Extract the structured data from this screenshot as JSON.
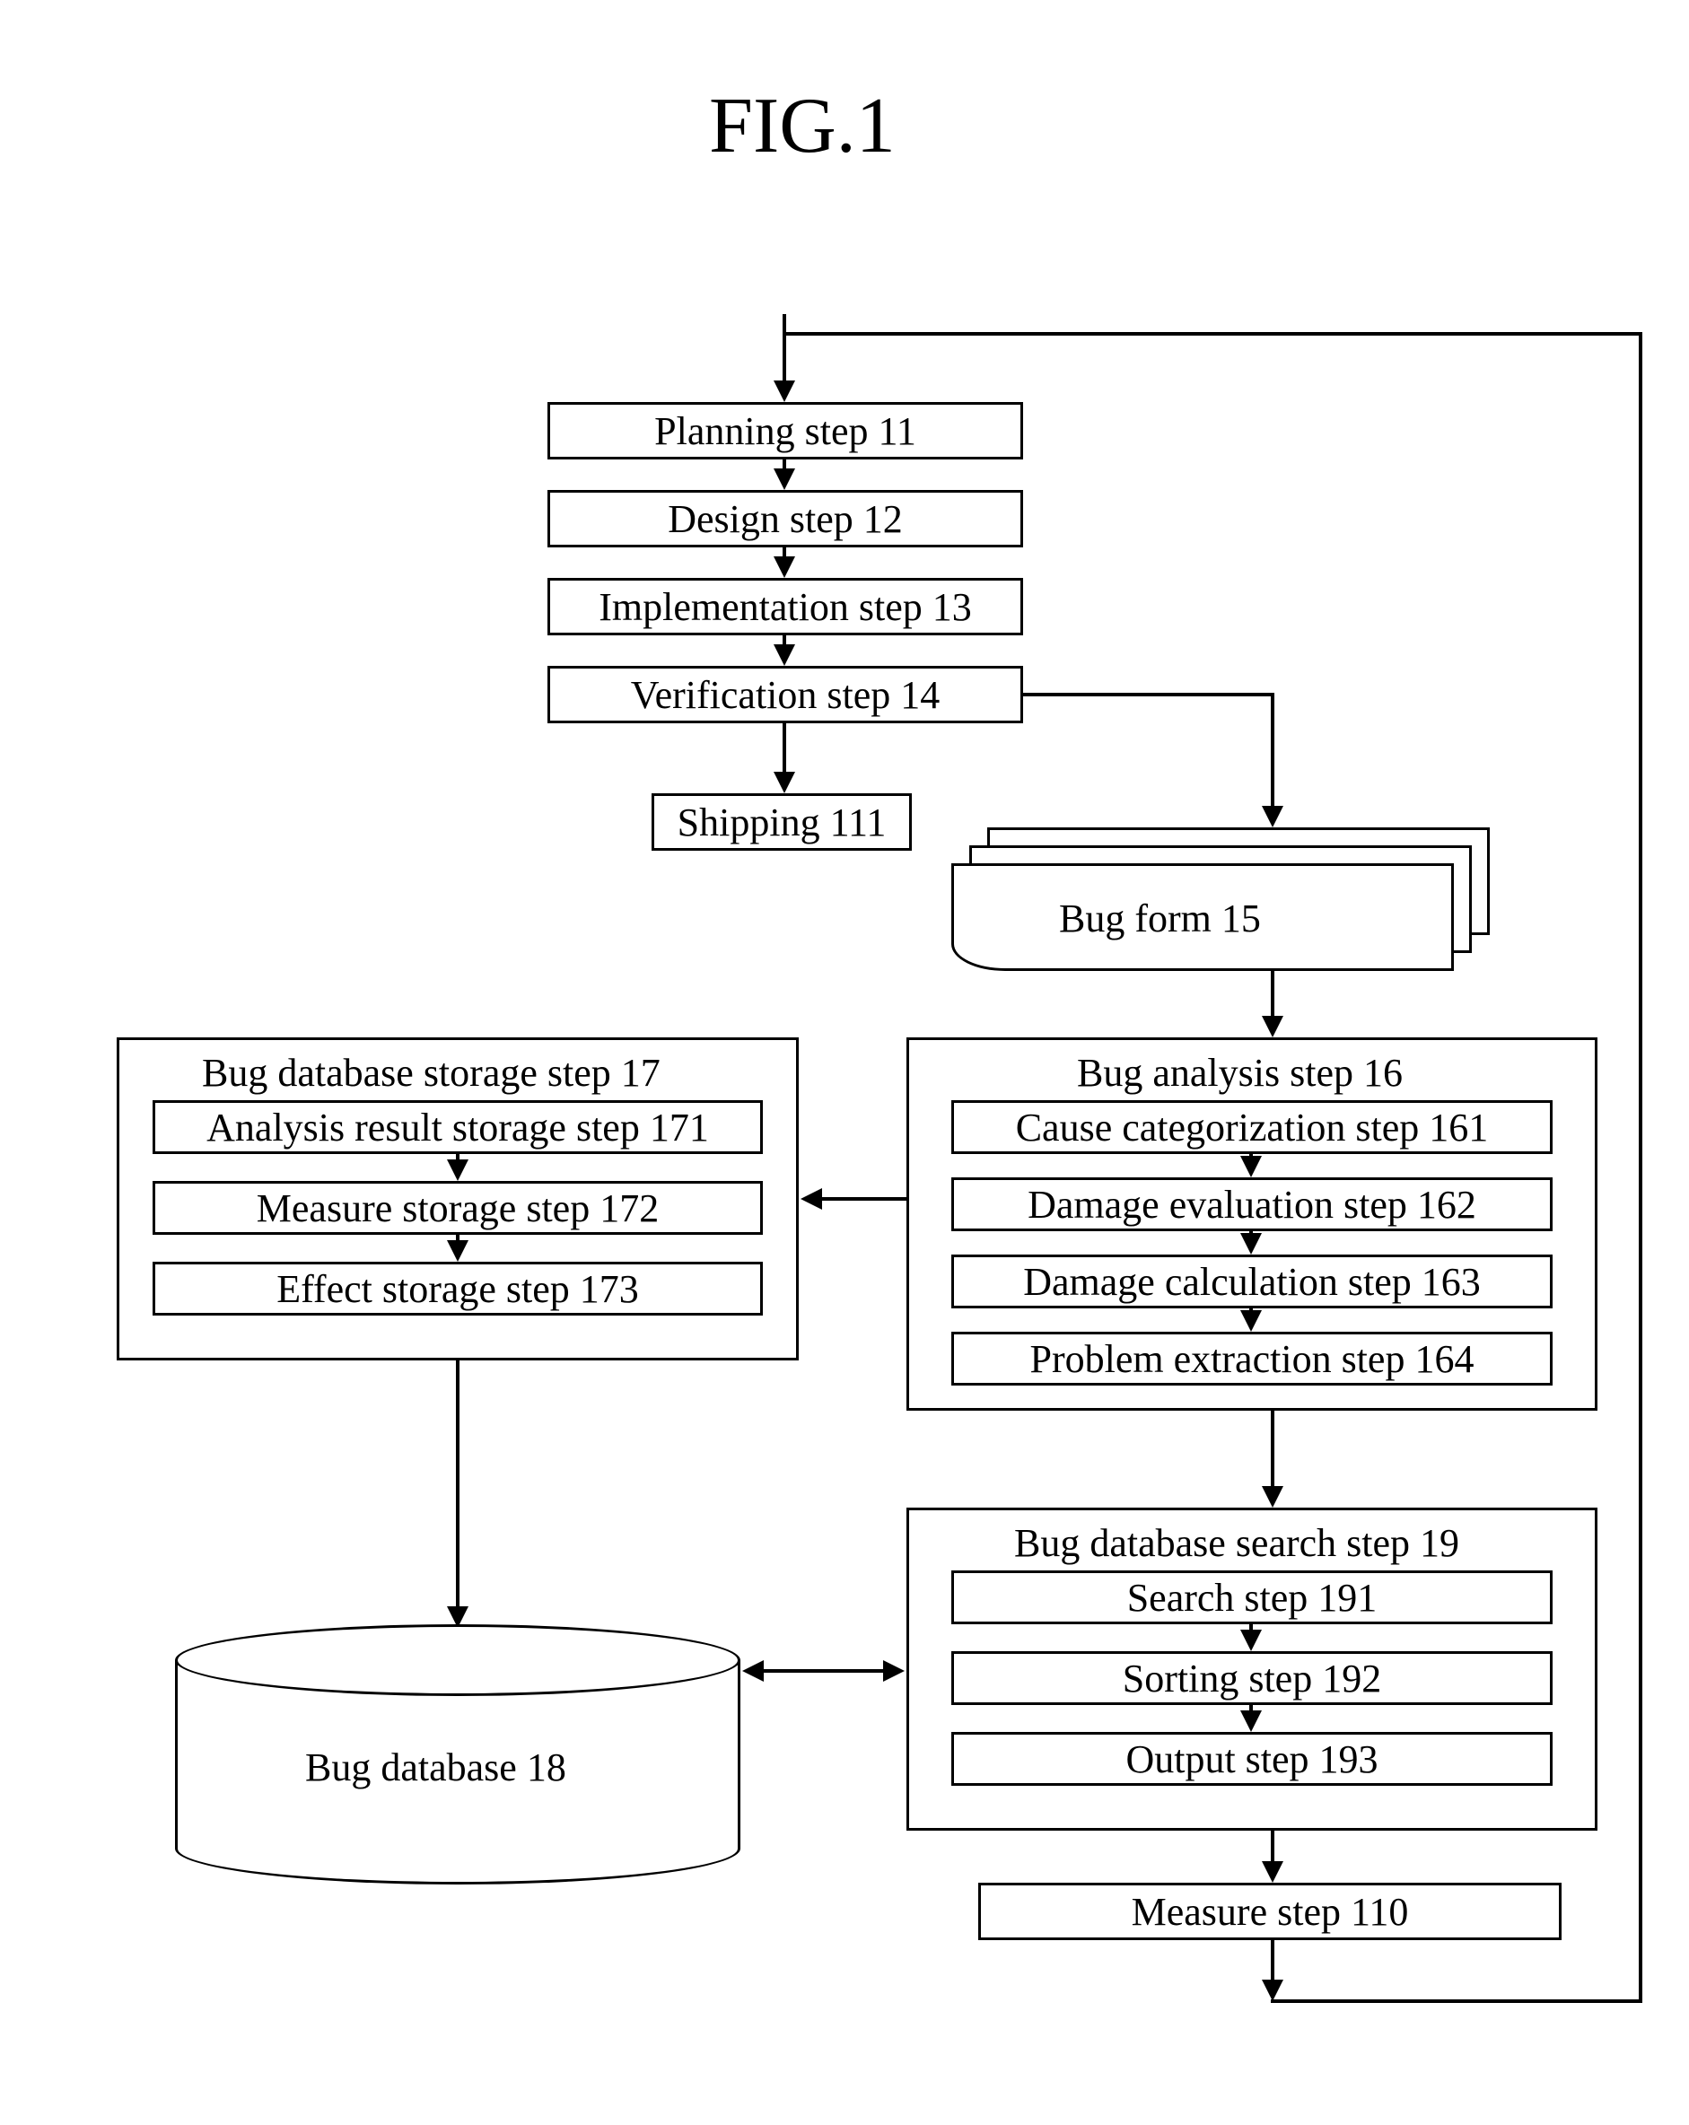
{
  "fig_title": "FIG.1",
  "steps": {
    "planning": "Planning step 11",
    "design": "Design step 12",
    "implementation": "Implementation step 13",
    "verification": "Verification step 14",
    "shipping": "Shipping 111",
    "measure": "Measure step 110"
  },
  "bug_form": "Bug form 15",
  "group16": {
    "title": "Bug analysis step 16",
    "s161": "Cause categorization step 161",
    "s162": "Damage evaluation step 162",
    "s163": "Damage calculation step 163",
    "s164": "Problem extraction step 164"
  },
  "group17": {
    "title": "Bug database storage step 17",
    "s171": "Analysis result storage step 171",
    "s172": "Measure storage step 172",
    "s173": "Effect storage step 173"
  },
  "db18": "Bug database 18",
  "group19": {
    "title": "Bug database search step 19",
    "s191": "Search step 191",
    "s192": "Sorting step 192",
    "s193": "Output step 193"
  }
}
